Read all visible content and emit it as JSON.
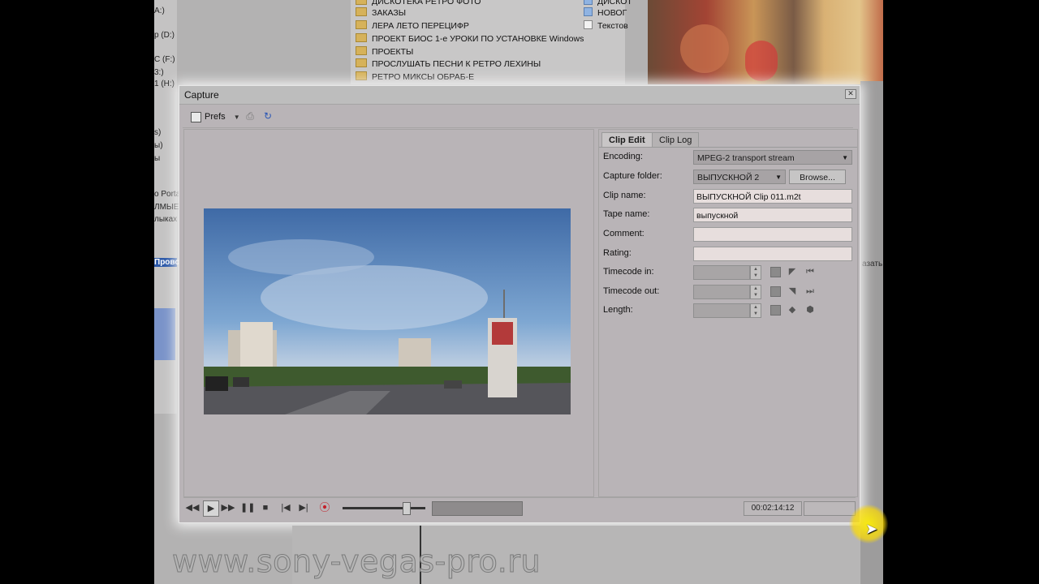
{
  "bg": {
    "left_labels": [
      "A:)",
      "p (D:)",
      "C (F:)",
      "3:)",
      "1 (H:)",
      "s)",
      "ы)",
      "ы",
      "o Porta",
      "ЛМЫЕ",
      "лыках"
    ],
    "folders": [
      "ДИСКОТЕКА РЕТРО ФОТО",
      "ЗАКАЗЫ",
      "ЛЕРА ЛЕТО ПЕРЕЦИФР",
      "ПРОЕКТ БИОС 1-е УРОКИ ПО УСТАНОВКЕ Windows",
      "ПРОЕКТЫ",
      "ПРОСЛУШАТЬ ПЕСНИ К РЕТРО ЛЕХИНЫ",
      "РЕТРО МИКСЫ ОБРАБ-Е"
    ],
    "files": [
      "ДИСКОТ",
      "НОВОГ",
      "Текстов"
    ],
    "left_edge": "Прово",
    "right_edge": "азать",
    "watermark": "www.sony-vegas-pro.ru"
  },
  "window": {
    "title": "Capture",
    "toolbar": {
      "prefs_label": "Prefs"
    },
    "tabs": [
      {
        "label": "Clip Edit",
        "active": true
      },
      {
        "label": "Clip Log",
        "active": false
      }
    ],
    "fields": {
      "encoding_label": "Encoding:",
      "encoding_value": "MPEG-2 transport stream",
      "capture_folder_label": "Capture folder:",
      "capture_folder_value": "ВЫПУСКНОЙ 2",
      "browse_label": "Browse...",
      "clip_name_label": "Clip name:",
      "clip_name_value": "ВЫПУСКНОЙ Clip 011.m2t",
      "tape_name_label": "Tape name:",
      "tape_name_value": "выпускной",
      "comment_label": "Comment:",
      "comment_value": "",
      "rating_label": "Rating:",
      "rating_value": "",
      "timecode_in_label": "Timecode in:",
      "timecode_out_label": "Timecode out:",
      "length_label": "Length:"
    },
    "transport": {
      "timecode": "00:02:14:12"
    }
  }
}
